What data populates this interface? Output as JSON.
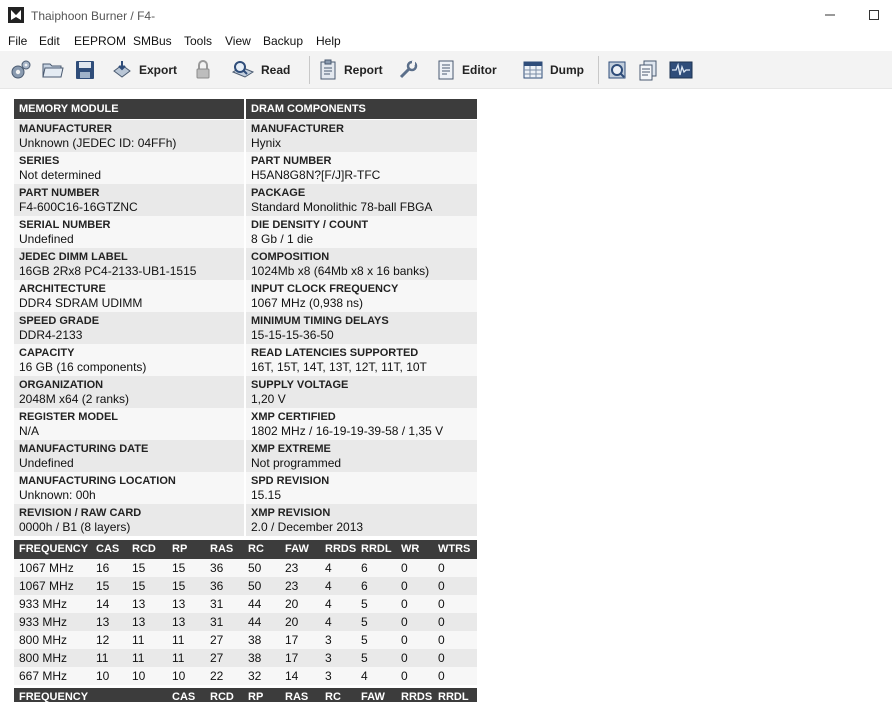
{
  "window": {
    "title": "Thaiphoon Burner / F4-"
  },
  "menu": [
    "File",
    "Edit",
    "EEPROM",
    "SMBus",
    "Tools",
    "View",
    "Backup",
    "Help"
  ],
  "toolbar": {
    "export_label": "Export",
    "read_label": "Read",
    "report_label": "Report",
    "editor_label": "Editor",
    "dump_label": "Dump"
  },
  "memory_module": {
    "header": "MEMORY MODULE",
    "rows": [
      {
        "label": "MANUFACTURER",
        "value": "Unknown (JEDEC ID: 04FFh)"
      },
      {
        "label": "SERIES",
        "value": "Not determined"
      },
      {
        "label": "PART NUMBER",
        "value": "F4-600C16-16GTZNC"
      },
      {
        "label": "SERIAL NUMBER",
        "value": "Undefined"
      },
      {
        "label": "JEDEC DIMM LABEL",
        "value": "16GB 2Rx8 PC4-2133-UB1-1515"
      },
      {
        "label": "ARCHITECTURE",
        "value": "DDR4 SDRAM UDIMM"
      },
      {
        "label": "SPEED GRADE",
        "value": "DDR4-2133"
      },
      {
        "label": "CAPACITY",
        "value": "16 GB (16 components)"
      },
      {
        "label": "ORGANIZATION",
        "value": "2048M x64 (2 ranks)"
      },
      {
        "label": "REGISTER MODEL",
        "value": "N/A"
      },
      {
        "label": "MANUFACTURING DATE",
        "value": "Undefined"
      },
      {
        "label": "MANUFACTURING LOCATION",
        "value": "Unknown: 00h"
      },
      {
        "label": "REVISION / RAW CARD",
        "value": "0000h / B1 (8 layers)"
      }
    ]
  },
  "dram_components": {
    "header": "DRAM COMPONENTS",
    "rows": [
      {
        "label": "MANUFACTURER",
        "value": "Hynix"
      },
      {
        "label": "PART NUMBER",
        "value": "H5AN8G8N?[F/J]R-TFC"
      },
      {
        "label": "PACKAGE",
        "value": "Standard Monolithic 78-ball FBGA"
      },
      {
        "label": "DIE DENSITY / COUNT",
        "value": "8 Gb / 1 die"
      },
      {
        "label": "COMPOSITION",
        "value": "1024Mb x8 (64Mb x8 x 16 banks)"
      },
      {
        "label": "INPUT CLOCK FREQUENCY",
        "value": "1067 MHz (0,938 ns)"
      },
      {
        "label": "MINIMUM TIMING DELAYS",
        "value": "15-15-15-36-50"
      },
      {
        "label": "READ LATENCIES SUPPORTED",
        "value": "16T, 15T, 14T, 13T, 12T, 11T, 10T"
      },
      {
        "label": "SUPPLY VOLTAGE",
        "value": "1,20 V"
      },
      {
        "label": "XMP CERTIFIED",
        "value": "1802 MHz / 16-19-19-39-58 / 1,35 V"
      },
      {
        "label": "XMP EXTREME",
        "value": "Not programmed"
      },
      {
        "label": "SPD REVISION",
        "value": "15.15"
      },
      {
        "label": "XMP REVISION",
        "value": "2.0 / December 2013"
      }
    ]
  },
  "timings": {
    "headers": [
      "FREQUENCY",
      "CAS",
      "RCD",
      "RP",
      "RAS",
      "RC",
      "FAW",
      "RRDS",
      "RRDL",
      "WR",
      "WTRS"
    ],
    "rows": [
      [
        "1067 MHz",
        "16",
        "15",
        "15",
        "36",
        "50",
        "23",
        "4",
        "6",
        "0",
        "0"
      ],
      [
        "1067 MHz",
        "15",
        "15",
        "15",
        "36",
        "50",
        "23",
        "4",
        "6",
        "0",
        "0"
      ],
      [
        "933 MHz",
        "14",
        "13",
        "13",
        "31",
        "44",
        "20",
        "4",
        "5",
        "0",
        "0"
      ],
      [
        "933 MHz",
        "13",
        "13",
        "13",
        "31",
        "44",
        "20",
        "4",
        "5",
        "0",
        "0"
      ],
      [
        "800 MHz",
        "12",
        "11",
        "11",
        "27",
        "38",
        "17",
        "3",
        "5",
        "0",
        "0"
      ],
      [
        "800 MHz",
        "11",
        "11",
        "11",
        "27",
        "38",
        "17",
        "3",
        "5",
        "0",
        "0"
      ],
      [
        "667 MHz",
        "10",
        "10",
        "10",
        "22",
        "32",
        "14",
        "3",
        "4",
        "0",
        "0"
      ]
    ]
  },
  "xmp_timings": {
    "headers": [
      "FREQUENCY",
      "CAS",
      "RCD",
      "RP",
      "RAS",
      "RC",
      "FAW",
      "RRDS",
      "RRDL"
    ]
  }
}
